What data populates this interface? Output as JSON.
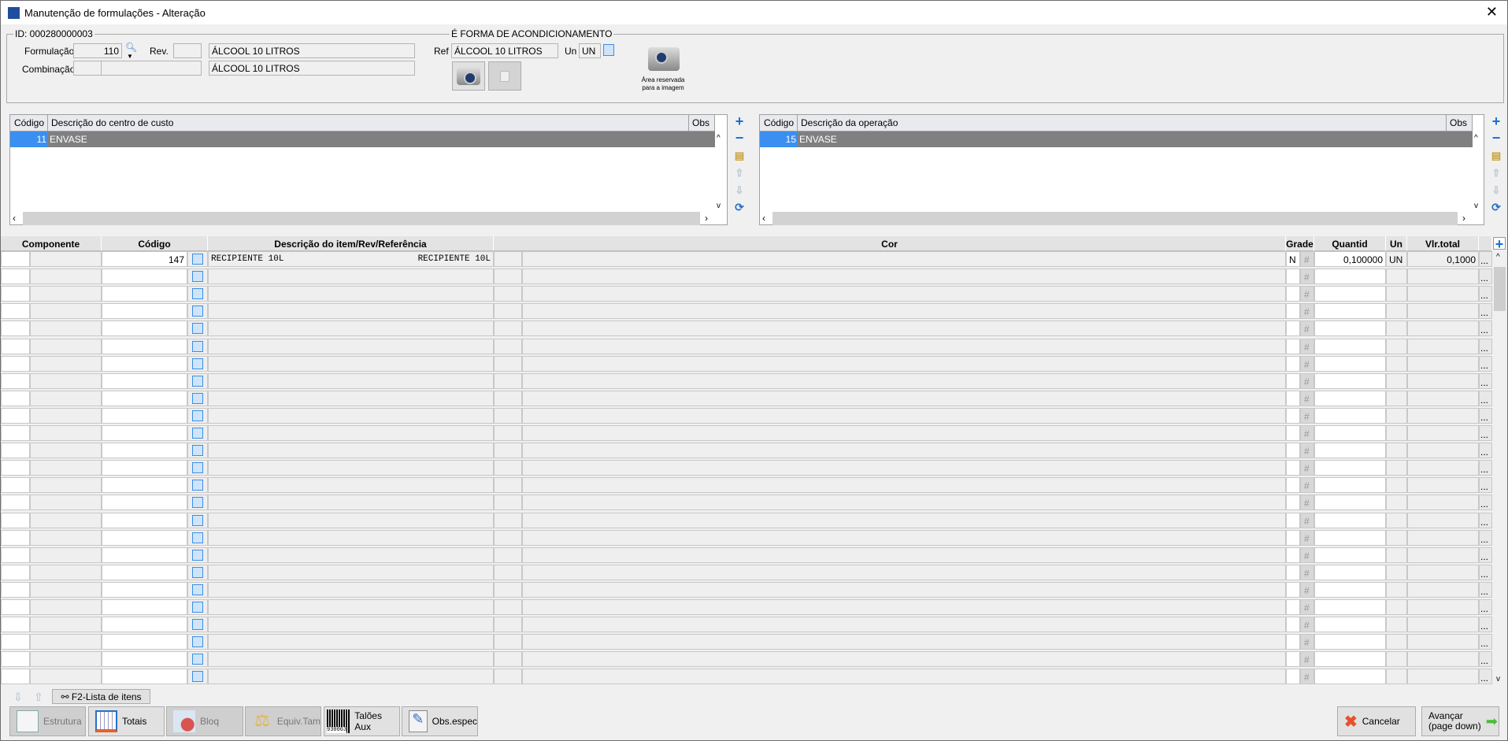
{
  "window": {
    "title": "Manutenção de formulações - Alteração"
  },
  "header": {
    "id_label": "ID: 000280000003",
    "formulacao_label": "Formulação",
    "formulacao": "110",
    "rev_label": "Rev.",
    "rev": "",
    "descricao": "ÁLCOOL 10 LITROS",
    "combinacao_label": "Combinação",
    "combinacao_1": "",
    "combinacao_2": "",
    "combinacao_desc": "ÁLCOOL 10 LITROS",
    "acond_legend": "É FORMA DE ACONDICIONAMENTO",
    "ref_label": "Ref",
    "ref": "ÁLCOOL 10 LITROS",
    "un_label": "Un",
    "un": "UN",
    "image_area_text_1": "Área reservada",
    "image_area_text_2": "para a imagem"
  },
  "cost_center_grid": {
    "headers": [
      "Código",
      "Descrição do centro de custo",
      "Obs"
    ],
    "rows": [
      {
        "codigo": "11",
        "descricao": "ENVASE",
        "obs": ""
      }
    ]
  },
  "operation_grid": {
    "headers": [
      "Código",
      "Descrição da operação",
      "Obs"
    ],
    "rows": [
      {
        "codigo": "15",
        "descricao": "ENVASE",
        "obs": ""
      }
    ]
  },
  "items_grid": {
    "headers": {
      "componente": "Componente",
      "codigo": "Código",
      "descricao": "Descrição do item/Rev/Referência",
      "cor": "Cor",
      "grade": "Grade",
      "quantid": "Quantid",
      "un": "Un",
      "vlr_total": "Vlr.total"
    },
    "rows": [
      {
        "codigo": "147",
        "descricao": "RECIPIENTE 10L",
        "referencia": "RECIPIENTE 10L",
        "grade": "N",
        "quantid": "0,100000",
        "un": "UN",
        "vlr_total": "0,1000"
      },
      {},
      {},
      {},
      {},
      {},
      {},
      {},
      {},
      {},
      {},
      {},
      {},
      {},
      {},
      {},
      {},
      {},
      {},
      {},
      {},
      {},
      {},
      {},
      {}
    ],
    "hash_symbol": "#",
    "ellipsis": "..."
  },
  "footer": {
    "list_button": "F2-Lista de itens",
    "buttons": {
      "estrutura": "Estrutura",
      "totais": "Totais",
      "bloq": "Bloq",
      "equiv": "Equiv.Tam",
      "taloes": "Talões Aux",
      "obs": "Obs.espec"
    },
    "barcode_number": "930063",
    "cancel": "Cancelar",
    "advance_1": "Avançar",
    "advance_2": "(page down)"
  },
  "colors": {
    "selection": "#3b8ff0",
    "selected_row": "#808080",
    "add_icon": "#1a6fd6"
  }
}
